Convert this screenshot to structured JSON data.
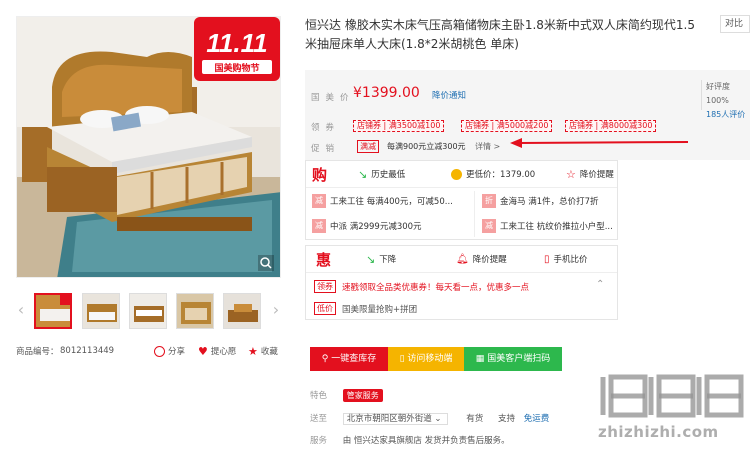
{
  "product": {
    "title": "恒兴达 橡胶木实木床气压高箱储物床主卧1.8米新中式双人床简约现代1.5米抽屉床单人大床(1.8*2米胡桃色 单床)",
    "compare_label": "对比"
  },
  "image": {
    "badge_big": "11.11",
    "badge_small": "国美购物节"
  },
  "meta": {
    "sku_label": "商品编号：",
    "sku": "8012113449",
    "share": "分享",
    "want": "提心愿",
    "favorite": "收藏"
  },
  "price": {
    "label": "国美价",
    "value": "¥1399.00",
    "notice": "降价通知",
    "rating_label": "好评度100%",
    "reviews": "185人评价"
  },
  "coupons": {
    "label": "领券",
    "items": [
      "店铺券 | 满3500减100",
      "店铺券 | 满5000减200",
      "店铺券 | 满8000减300"
    ]
  },
  "promo": {
    "label": "促销",
    "tag": "满减",
    "text": "每满900元立减300元",
    "detail": "详情 >"
  },
  "gome_card": {
    "logo": "购",
    "history": "历史最低",
    "lower": "更低价：1379.00",
    "drop": "降价提醒",
    "offers": [
      {
        "badge": "减",
        "text": "工来工往 每满400元，可减50..."
      },
      {
        "badge": "折",
        "text": "金海马 满1件，总价打7折"
      },
      {
        "badge": "减",
        "text": "中派 满2999元减300元"
      },
      {
        "badge": "减",
        "text": "工来工往 杭纹价推拉小户型..."
      }
    ]
  },
  "hui_card": {
    "logo": "惠",
    "drop": "下降",
    "remind": "降价提醒",
    "mobile": "手机比价",
    "tag1": "领券",
    "line1": "速戳领取全品类优惠券！每天看一点，优惠多一点",
    "tag2": "低价",
    "line2": "国美限量抢购+拼团"
  },
  "buttons": {
    "stock": "一键查库存",
    "mobile_store": "访问移动端",
    "scan": "国美客户端扫码"
  },
  "info": {
    "feature_label": "特色",
    "feature_badge": "管家服务",
    "delivery_label": "送至",
    "address": "北京市朝阳区朝外街道",
    "stock": "有货",
    "support": "支持",
    "free_install": "免运费",
    "service_label": "服务",
    "service_text": "由 恒兴达家具旗舰店 发货并负责售后服务。"
  },
  "watermark": {
    "site": "zhizhizhi.com"
  },
  "colors": {
    "accent": "#e3101e",
    "stock_btn": "#e3101e",
    "mobile_btn": "#f5b400",
    "scan_btn": "#2db84d",
    "link": "#1f6fb2"
  }
}
